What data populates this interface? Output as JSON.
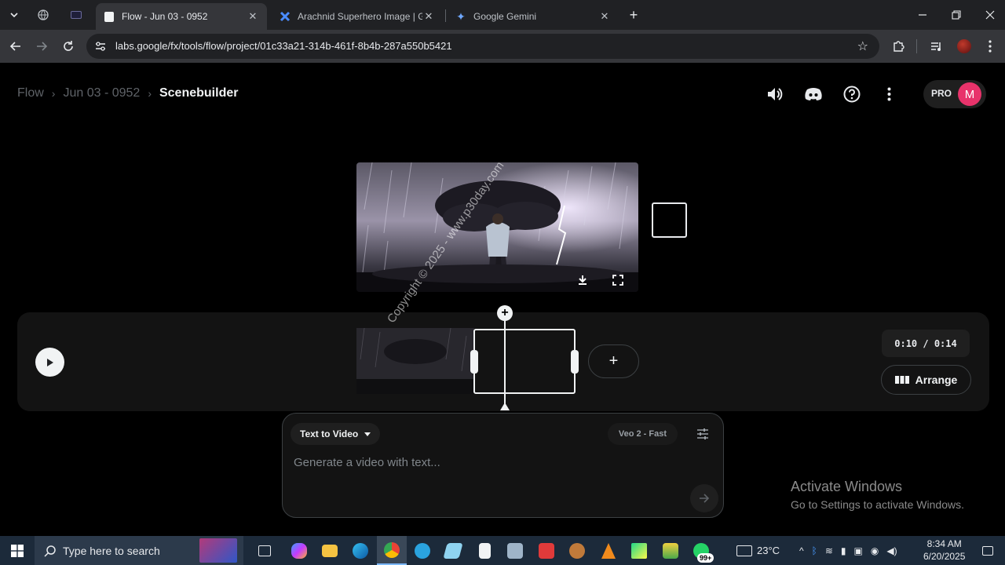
{
  "browser": {
    "tabs": [
      {
        "title": "Flow - Jun 03 - 0952",
        "active": true
      },
      {
        "title": "Arachnid Superhero Image | Go",
        "active": false
      },
      {
        "title": "Google Gemini",
        "active": false
      }
    ],
    "url": "labs.google/fx/tools/flow/project/01c33a21-314b-461f-8b4b-287a550b5421"
  },
  "breadcrumb": {
    "items": [
      "Flow",
      "Jun 03 - 0952",
      "Scenebuilder"
    ],
    "separator": "›"
  },
  "header": {
    "plan_badge": "PRO",
    "avatar_letter": "M",
    "avatar_color": "#e8336b"
  },
  "preview": {
    "watermark": "Copyright © 2025 - www.p30day.com"
  },
  "timeline": {
    "time_display": "0:10 / 0:14",
    "arrange_label": "Arrange",
    "add_clip_label": "+",
    "playhead_add_label": "+"
  },
  "prompt": {
    "mode_label": "Text to Video",
    "model_label": "Veo 2 - Fast",
    "placeholder": "Generate a video with text..."
  },
  "windows": {
    "activate_title": "Activate Windows",
    "activate_subtitle": "Go to Settings to activate Windows.",
    "search_placeholder": "Type here to search",
    "temperature": "23°C",
    "time": "8:34 AM",
    "date": "6/20/2025",
    "notification_badge": "99+"
  }
}
